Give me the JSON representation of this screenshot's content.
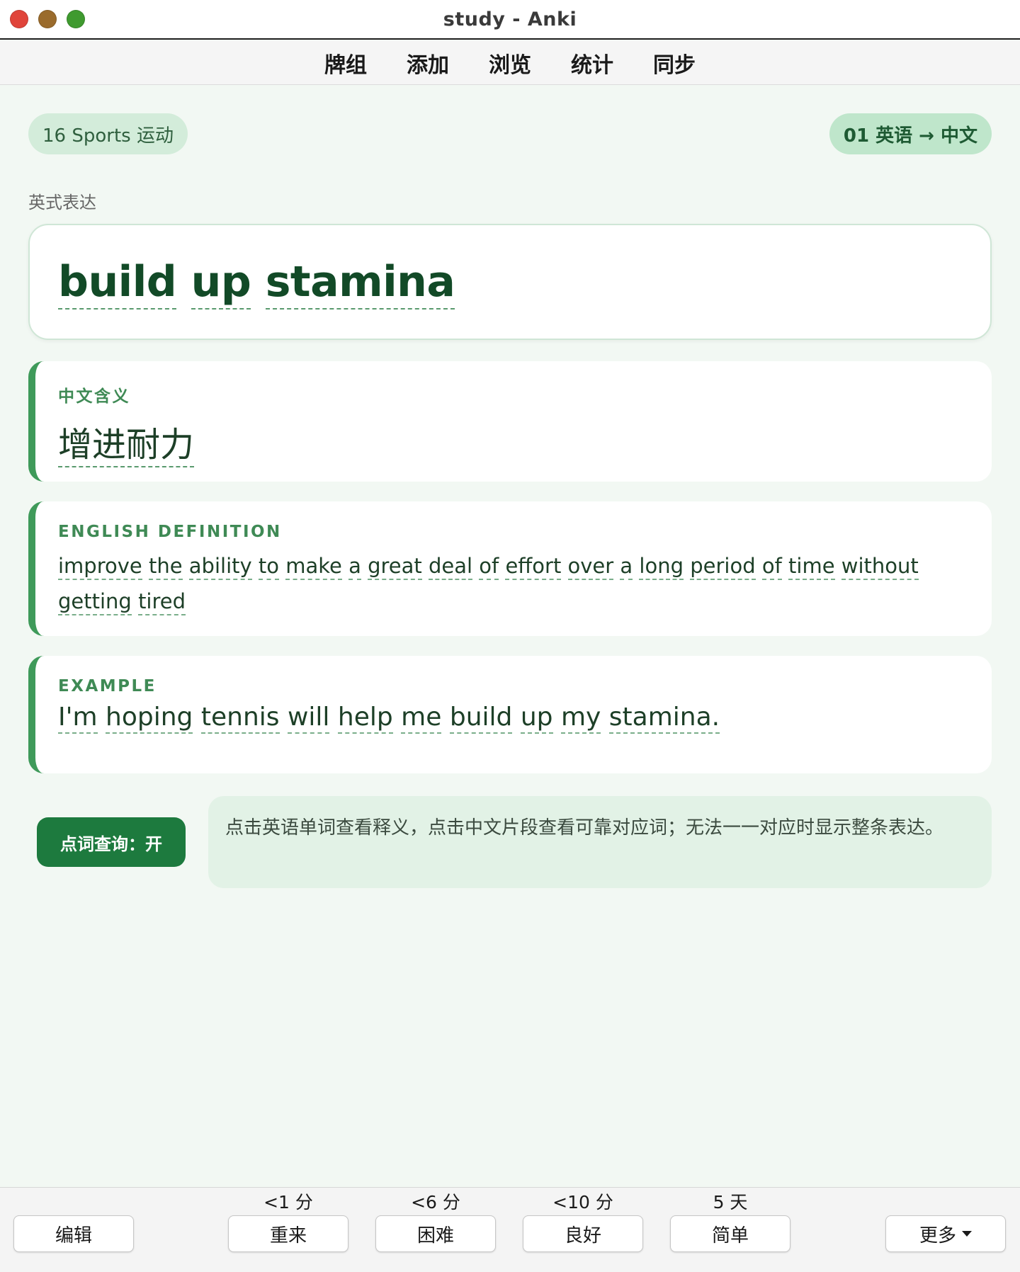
{
  "window": {
    "title": "study - Anki"
  },
  "topnav": {
    "items": [
      "牌组",
      "添加",
      "浏览",
      "统计",
      "同步"
    ]
  },
  "card": {
    "deck_pill": "16 Sports 运动",
    "direction_pill": "01 英语 → 中文",
    "section_label": "英式表达",
    "expression_words": [
      "build",
      "up",
      "stamina"
    ],
    "chinese": {
      "label": "中文含义",
      "meaning": "增进耐力"
    },
    "english": {
      "label": "ENGLISH DEFINITION",
      "definition_words": [
        "improve",
        "the",
        "ability",
        "to",
        "make",
        "a",
        "great",
        "deal",
        "of",
        "effort",
        "over",
        "a",
        "long",
        "period",
        "of",
        "time",
        "without",
        "getting",
        "tired"
      ]
    },
    "example": {
      "label": "EXAMPLE",
      "sentence_words": [
        "I'm",
        "hoping",
        "tennis",
        "will",
        "help",
        "me",
        "build",
        "up",
        "my",
        "stamina."
      ]
    }
  },
  "lookup": {
    "toggle_label": "点词查询：开",
    "hint": "点击英语单词查看释义，点击中文片段查看可靠对应词；无法一一对应时显示整条表达。"
  },
  "bottombar": {
    "edit": "编辑",
    "answers": [
      {
        "interval": "<1 分",
        "label": "重来"
      },
      {
        "interval": "<6 分",
        "label": "困难"
      },
      {
        "interval": "<10 分",
        "label": "良好"
      },
      {
        "interval": "5 天",
        "label": "简单"
      }
    ],
    "more": "更多"
  },
  "colors": {
    "accent_green": "#1d7a3e",
    "card_border": "#3f9a5a",
    "background": "#f2f8f3"
  }
}
